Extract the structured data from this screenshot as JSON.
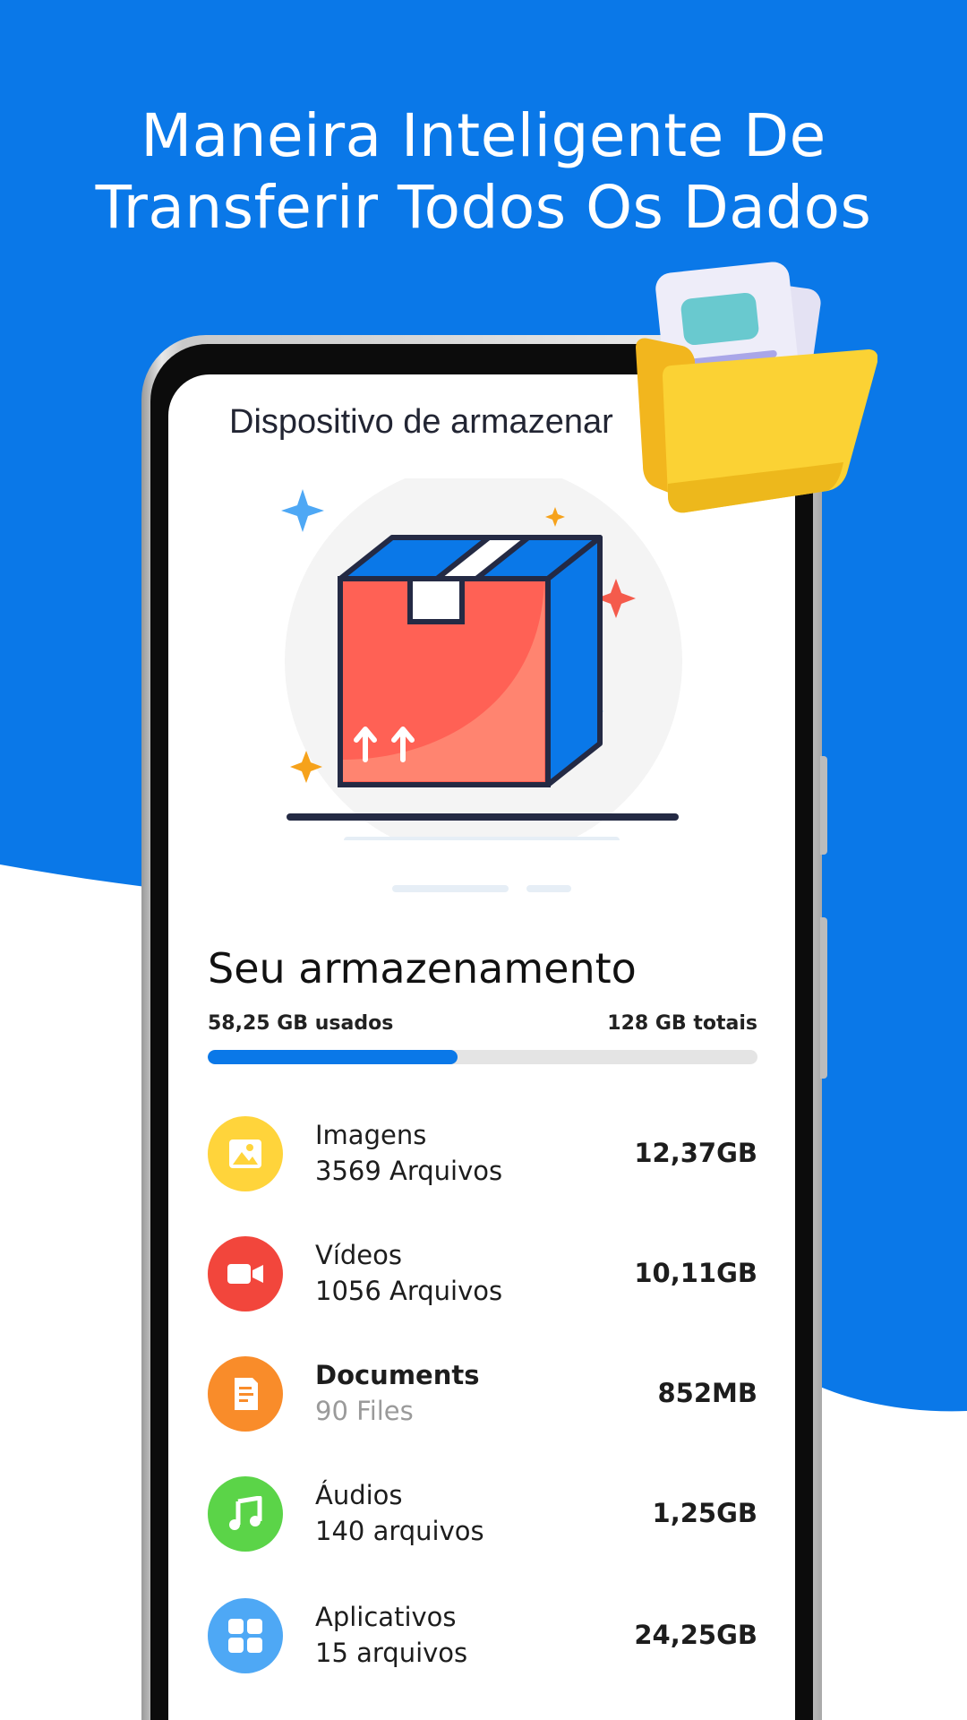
{
  "headline": {
    "line1": "Maneira Inteligente De",
    "line2": "Transferir Todos Os Dados"
  },
  "screen": {
    "title": "Dispositivo de armazenar"
  },
  "storage": {
    "title": "Seu armazenamento",
    "used_label": "58,25 GB usados",
    "total_label": "128 GB totais",
    "used_fraction": 0.455
  },
  "categories": [
    {
      "name": "Imagens",
      "count": "3569 Arquivos",
      "size": "12,37GB",
      "icon": "image-icon",
      "color": "#FFD43B"
    },
    {
      "name": "Vídeos",
      "count": "1056 Arquivos",
      "size": "10,11GB",
      "icon": "video-camera-icon",
      "color": "#F2463C"
    },
    {
      "name": "Documents",
      "count": "90 Files",
      "size": "852MB",
      "icon": "document-icon",
      "color": "#F98C2A"
    },
    {
      "name": "Áudios",
      "count": "140 arquivos",
      "size": "1,25GB",
      "icon": "music-note-icon",
      "color": "#5BD448"
    },
    {
      "name": "Aplicativos",
      "count": "15 arquivos",
      "size": "24,25GB",
      "icon": "apps-grid-icon",
      "color": "#4EA8F5"
    }
  ],
  "colors": {
    "brand_blue": "#0A78E8",
    "background_white": "#FFFFFF"
  }
}
